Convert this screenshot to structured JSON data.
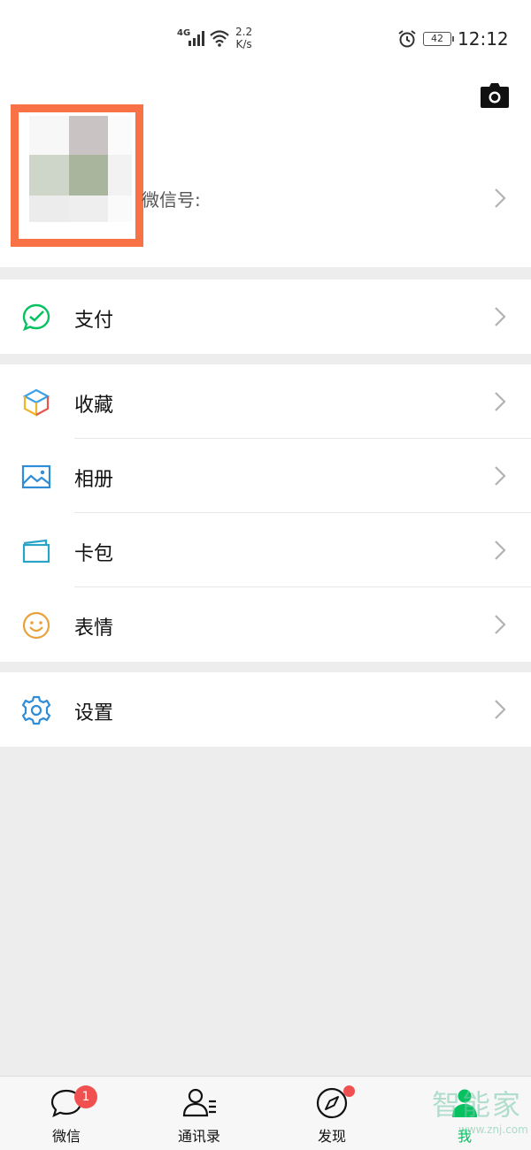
{
  "status_bar": {
    "network": "4G",
    "speed_value": "2.2",
    "speed_unit": "K/s",
    "battery": "42",
    "time": "12:12"
  },
  "profile": {
    "wechat_id_label": "微信号:",
    "icons": [
      "camera-icon",
      "chevron-right-icon"
    ]
  },
  "menu": {
    "pay": "支付",
    "favorites": "收藏",
    "album": "相册",
    "cards": "卡包",
    "stickers": "表情",
    "settings": "设置"
  },
  "tabbar": {
    "chats": "微信",
    "chats_badge": "1",
    "contacts": "通讯录",
    "discover": "发现",
    "me": "我"
  },
  "watermark": {
    "text": "智能家",
    "sub": "www.znj.com"
  },
  "colors": {
    "accent_green": "#07c160",
    "highlight_orange": "#f97245",
    "badge_red": "#f05050",
    "background": "#ededed"
  }
}
